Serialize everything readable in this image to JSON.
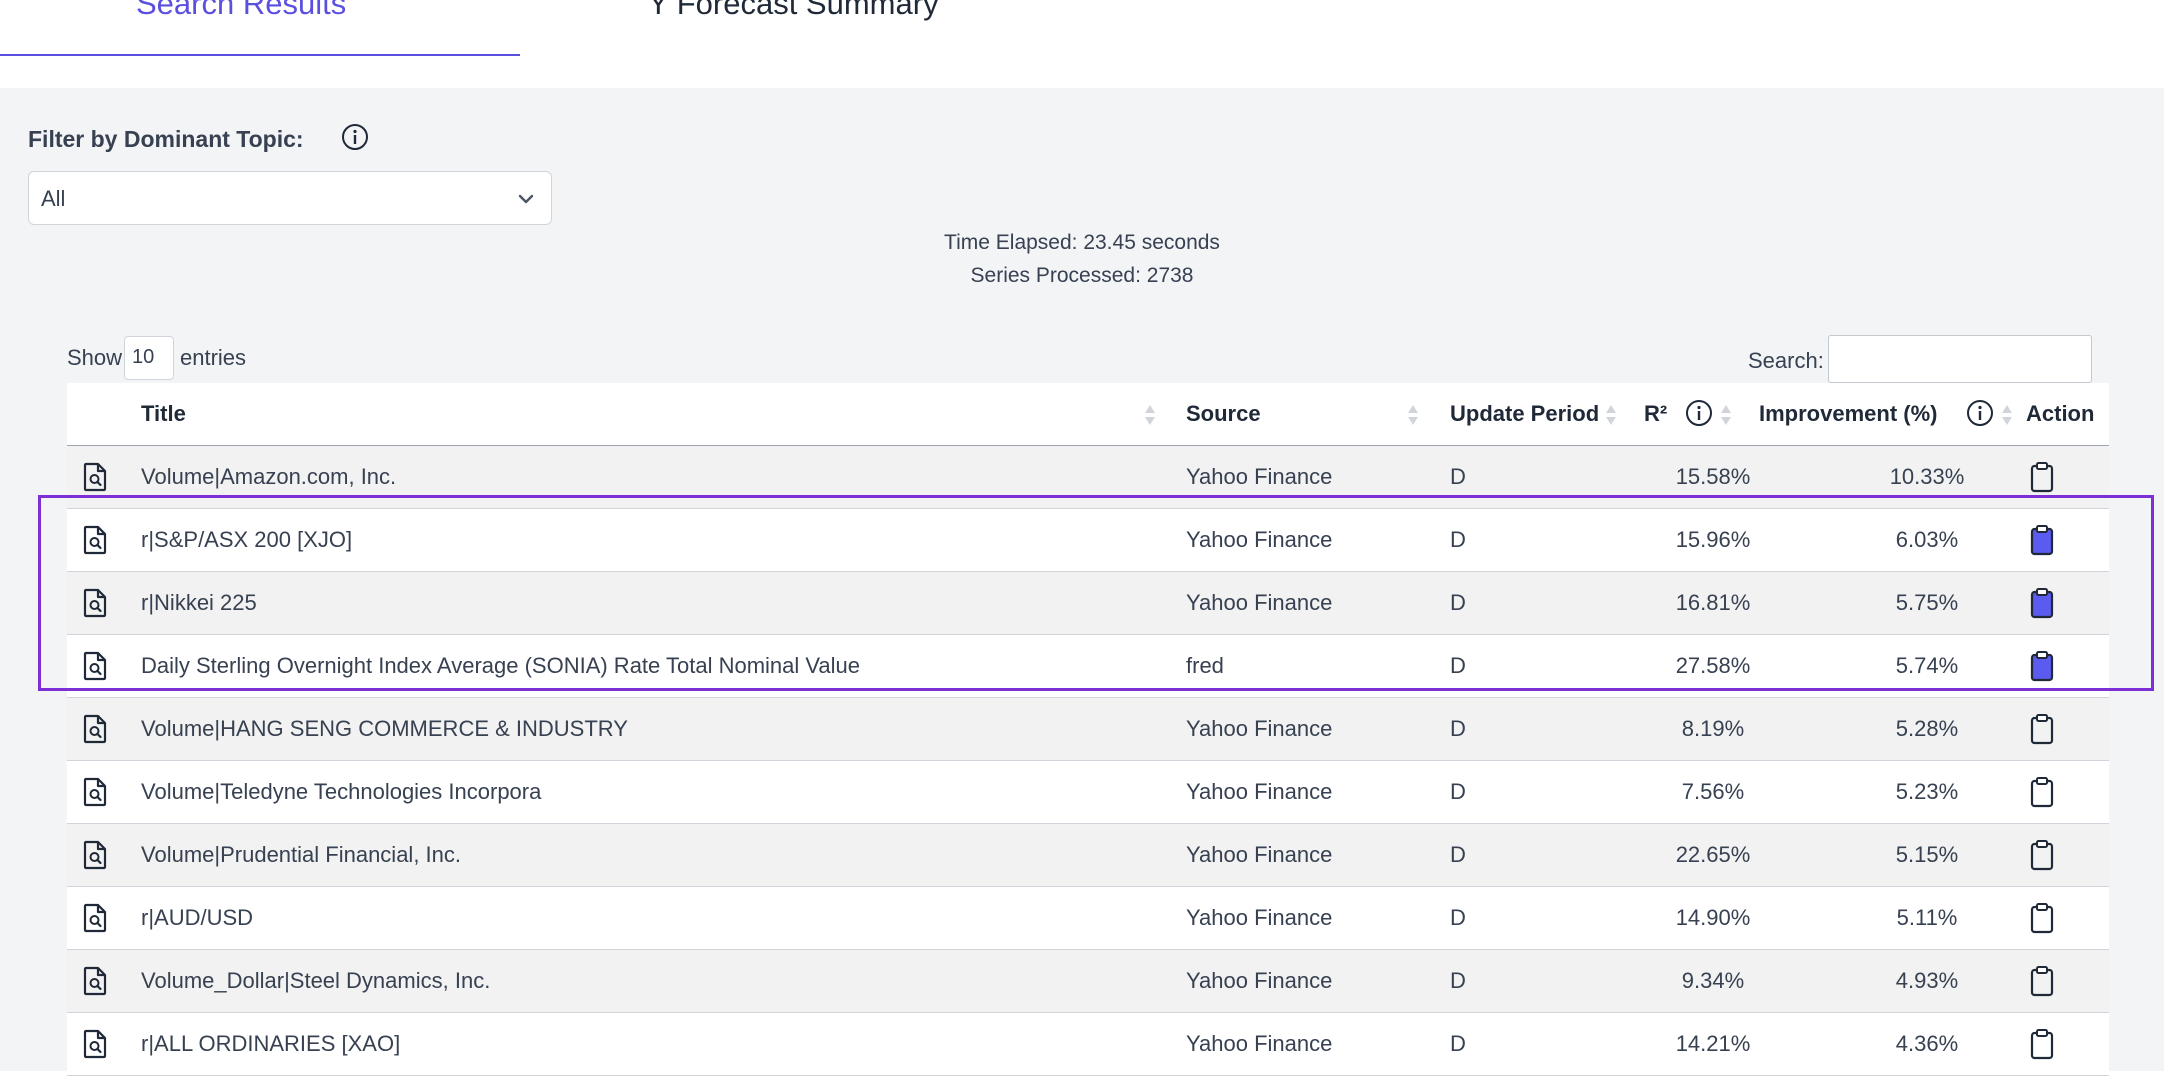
{
  "tabs": {
    "active_label": "Search Results",
    "inactive_label": "Y Forecast Summary"
  },
  "filter": {
    "label": "Filter by Dominant Topic:",
    "selected": "All"
  },
  "stats": {
    "time_elapsed": "Time Elapsed: 23.45 seconds",
    "series_processed": "Series Processed: 2738"
  },
  "controls": {
    "show_label": "Show",
    "entries_value": "10",
    "entries_label": "entries",
    "search_label": "Search:",
    "search_value": ""
  },
  "table": {
    "headers": {
      "title": "Title",
      "source": "Source",
      "update_period": "Update Period",
      "r2": "R²",
      "improvement": "Improvement (%)",
      "action": "Action"
    },
    "rows": [
      {
        "title": "Volume|Amazon.com, Inc.",
        "source": "Yahoo Finance",
        "period": "D",
        "r2": "15.58%",
        "improvement": "10.33%",
        "copied": false
      },
      {
        "title": "r|S&P/ASX 200 [XJO]",
        "source": "Yahoo Finance",
        "period": "D",
        "r2": "15.96%",
        "improvement": "6.03%",
        "copied": true
      },
      {
        "title": "r|Nikkei 225",
        "source": "Yahoo Finance",
        "period": "D",
        "r2": "16.81%",
        "improvement": "5.75%",
        "copied": true
      },
      {
        "title": "Daily Sterling Overnight Index Average (SONIA) Rate Total Nominal Value",
        "source": "fred",
        "period": "D",
        "r2": "27.58%",
        "improvement": "5.74%",
        "copied": true
      },
      {
        "title": "Volume|HANG SENG COMMERCE & INDUSTRY",
        "source": "Yahoo Finance",
        "period": "D",
        "r2": "8.19%",
        "improvement": "5.28%",
        "copied": false
      },
      {
        "title": "Volume|Teledyne Technologies Incorpora",
        "source": "Yahoo Finance",
        "period": "D",
        "r2": "7.56%",
        "improvement": "5.23%",
        "copied": false
      },
      {
        "title": "Volume|Prudential Financial, Inc.",
        "source": "Yahoo Finance",
        "period": "D",
        "r2": "22.65%",
        "improvement": "5.15%",
        "copied": false
      },
      {
        "title": "r|AUD/USD",
        "source": "Yahoo Finance",
        "period": "D",
        "r2": "14.90%",
        "improvement": "5.11%",
        "copied": false
      },
      {
        "title": "Volume_Dollar|Steel Dynamics, Inc.",
        "source": "Yahoo Finance",
        "period": "D",
        "r2": "9.34%",
        "improvement": "4.93%",
        "copied": false
      },
      {
        "title": "r|ALL ORDINARIES [XAO]",
        "source": "Yahoo Finance",
        "period": "D",
        "r2": "14.21%",
        "improvement": "4.36%",
        "copied": false
      }
    ]
  },
  "colors": {
    "accent": "#5b4fe0",
    "highlight_border": "#7b2fd4",
    "copied_clipboard_fill": "#5b5bf0"
  },
  "icons": {
    "row_icon": "document-search-icon",
    "action_icon": "clipboard-icon",
    "info_icon": "info-icon",
    "sort_icon": "sort-arrows-icon",
    "dropdown_icon": "chevron-down-icon"
  }
}
